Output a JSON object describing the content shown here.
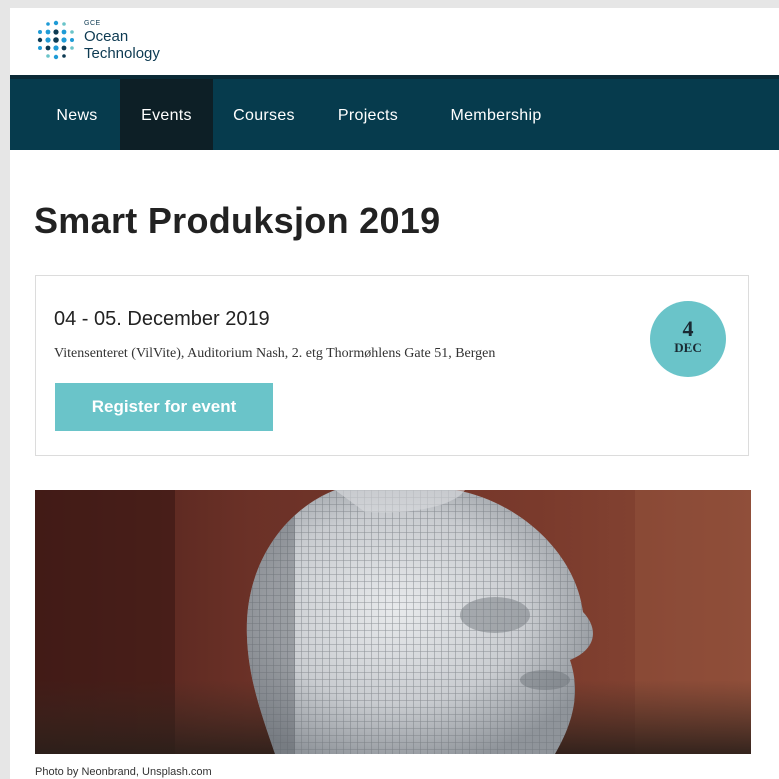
{
  "logo": {
    "small": "GCE",
    "line1": "Ocean",
    "line2": "Technology",
    "dot_colors": [
      "#1f9bd6",
      "#0d3a52",
      "#6ac4c9"
    ]
  },
  "nav": {
    "items": [
      {
        "label": "News",
        "active": false
      },
      {
        "label": "Events",
        "active": true
      },
      {
        "label": "Courses",
        "active": false
      },
      {
        "label": "Projects",
        "active": false
      },
      {
        "label": "Membership",
        "active": false
      }
    ]
  },
  "page": {
    "title": "Smart Produksjon 2019"
  },
  "event": {
    "date_range": "04 - 05. December 2019",
    "location": "Vitensenteret (VilVite), Auditorium Nash, 2. etg Thormøhlens Gate 51, Bergen",
    "register_label": "Register for event",
    "badge_day": "4",
    "badge_month": "DEC"
  },
  "hero": {
    "caption": "Photo by Neonbrand, Unsplash.com"
  },
  "colors": {
    "nav_bg": "#063b4d",
    "nav_active": "#0d1f26",
    "accent": "#6ac4c9"
  }
}
